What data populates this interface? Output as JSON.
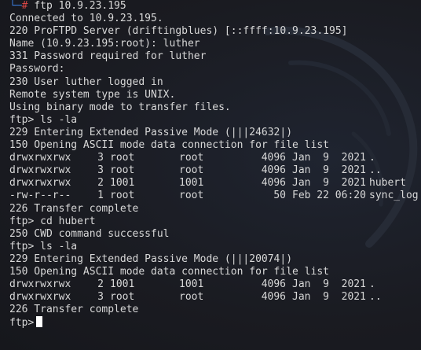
{
  "session": {
    "prompt_corner": "└─",
    "prompt_arrow": "#",
    "command": "ftp 10.9.23.195"
  },
  "output_top": [
    "Connected to 10.9.23.195.",
    "220 ProFTPD Server (driftingblues) [::ffff:10.9.23.195]",
    "Name (10.9.23.195:root): luther",
    "331 Password required for luther",
    "Password:",
    "230 User luther logged in",
    "Remote system type is UNIX.",
    "Using binary mode to transfer files.",
    "ftp> ls -la",
    "229 Entering Extended Passive Mode (|||24632|)",
    "150 Opening ASCII mode data connection for file list"
  ],
  "listing1": [
    {
      "perm": "drwxrwxrwx",
      "links": "3",
      "owner": "root",
      "group": "root",
      "size": "4096",
      "date": "Jan  9  2021",
      "name": "."
    },
    {
      "perm": "drwxrwxrwx",
      "links": "3",
      "owner": "root",
      "group": "root",
      "size": "4096",
      "date": "Jan  9  2021",
      "name": ".."
    },
    {
      "perm": "drwxrwxrwx",
      "links": "2",
      "owner": "1001",
      "group": "1001",
      "size": "4096",
      "date": "Jan  9  2021",
      "name": "hubert"
    },
    {
      "perm": "-rw-r--r--",
      "links": "1",
      "owner": "root",
      "group": "root",
      "size": "50",
      "date": "Feb 22 06:20",
      "name": "sync_log"
    }
  ],
  "output_mid": [
    "226 Transfer complete",
    "ftp> cd hubert",
    "250 CWD command successful",
    "ftp> ls -la",
    "229 Entering Extended Passive Mode (|||20074|)",
    "150 Opening ASCII mode data connection for file list"
  ],
  "listing2": [
    {
      "perm": "drwxrwxrwx",
      "links": "2",
      "owner": "1001",
      "group": "1001",
      "size": "4096",
      "date": "Jan  9  2021",
      "name": "."
    },
    {
      "perm": "drwxrwxrwx",
      "links": "3",
      "owner": "root",
      "group": "root",
      "size": "4096",
      "date": "Jan  9  2021",
      "name": ".."
    }
  ],
  "output_end": "226 Transfer complete",
  "final_prompt": "ftp>",
  "colors": {
    "background": "#1a1b21",
    "text": "#d8d8d8",
    "prompt_corner": "#3a7ad9",
    "prompt_arrow": "#d94646"
  }
}
